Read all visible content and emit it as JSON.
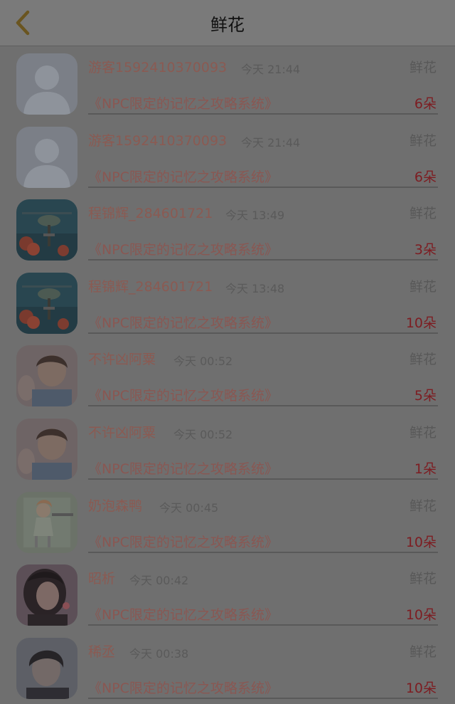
{
  "header": {
    "title": "鲜花"
  },
  "entries": [
    {
      "name": "游客1592410370093",
      "time": "今天 21:44",
      "type": "鲜花",
      "book": "《NPC限定的记忆之攻略系统》",
      "count": "6朵",
      "avatar": "default-avatar"
    },
    {
      "name": "游客1592410370093",
      "time": "今天 21:44",
      "type": "鲜花",
      "book": "《NPC限定的记忆之攻略系统》",
      "count": "6朵",
      "avatar": "default-avatar"
    },
    {
      "name": "程锦辉_284601721",
      "time": "今天 13:49",
      "type": "鲜花",
      "book": "《NPC限定的记忆之攻略系统》",
      "count": "3朵",
      "avatar": "helicopter-avatar"
    },
    {
      "name": "程锦辉_284601721",
      "time": "今天 13:48",
      "type": "鲜花",
      "book": "《NPC限定的记忆之攻略系统》",
      "count": "10朵",
      "avatar": "helicopter-avatar"
    },
    {
      "name": "不许凶阿粟",
      "time": "今天 00:52",
      "type": "鲜花",
      "book": "《NPC限定的记忆之攻略系统》",
      "count": "5朵",
      "avatar": "boy-avatar"
    },
    {
      "name": "不许凶阿粟",
      "time": "今天 00:52",
      "type": "鲜花",
      "book": "《NPC限定的记忆之攻略系统》",
      "count": "1朵",
      "avatar": "boy-avatar"
    },
    {
      "name": "奶泡森鸭",
      "time": "今天 00:45",
      "type": "鲜花",
      "book": "《NPC限定的记忆之攻略系统》",
      "count": "10朵",
      "avatar": "cartoon-girl-avatar"
    },
    {
      "name": "昭析",
      "time": "今天 00:42",
      "type": "鲜花",
      "book": "《NPC限定的记忆之攻略系统》",
      "count": "10朵",
      "avatar": "girl-avatar"
    },
    {
      "name": "稀丞",
      "time": "今天 00:38",
      "type": "鲜花",
      "book": "《NPC限定的记忆之攻略系统》",
      "count": "10朵",
      "avatar": "boy2-avatar"
    }
  ]
}
